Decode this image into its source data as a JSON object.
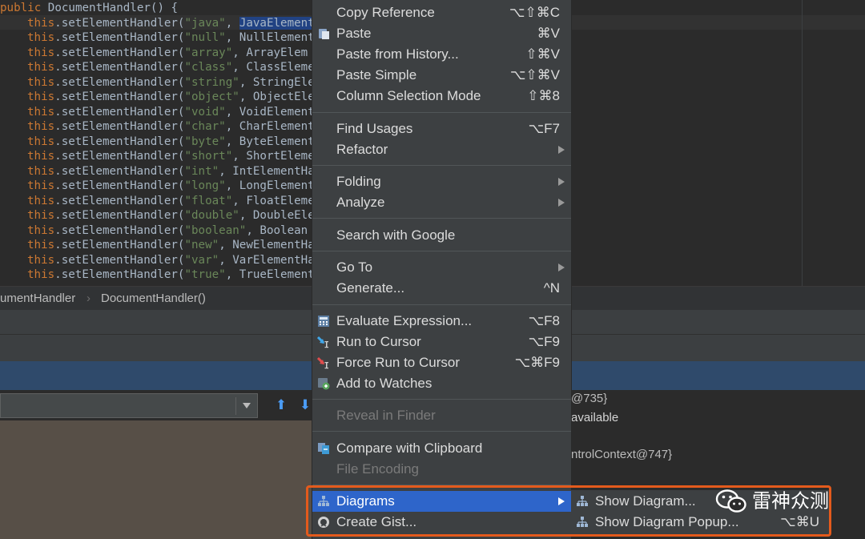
{
  "editor": {
    "lines": [
      {
        "kind": "header",
        "text": "public DocumentHandler() {"
      },
      {
        "kind": "call",
        "this": "this",
        "method": ".setElementHandler(",
        "arg": "\"java\"",
        "rest": ", JavaElement"
      },
      {
        "kind": "call",
        "this": "this",
        "method": ".setElementHandler(",
        "arg": "\"null\"",
        "rest": ", NullElement"
      },
      {
        "kind": "call",
        "this": "this",
        "method": ".setElementHandler(",
        "arg": "\"array\"",
        "rest": ", ArrayElem"
      },
      {
        "kind": "call",
        "this": "this",
        "method": ".setElementHandler(",
        "arg": "\"class\"",
        "rest": ", ClassEleme"
      },
      {
        "kind": "call",
        "this": "this",
        "method": ".setElementHandler(",
        "arg": "\"string\"",
        "rest": ", StringEle"
      },
      {
        "kind": "call",
        "this": "this",
        "method": ".setElementHandler(",
        "arg": "\"object\"",
        "rest": ", ObjectEle"
      },
      {
        "kind": "call",
        "this": "this",
        "method": ".setElementHandler(",
        "arg": "\"void\"",
        "rest": ", VoidElement"
      },
      {
        "kind": "call",
        "this": "this",
        "method": ".setElementHandler(",
        "arg": "\"char\"",
        "rest": ", CharElement"
      },
      {
        "kind": "call",
        "this": "this",
        "method": ".setElementHandler(",
        "arg": "\"byte\"",
        "rest": ", ByteElement"
      },
      {
        "kind": "call",
        "this": "this",
        "method": ".setElementHandler(",
        "arg": "\"short\"",
        "rest": ", ShortEleme"
      },
      {
        "kind": "call",
        "this": "this",
        "method": ".setElementHandler(",
        "arg": "\"int\"",
        "rest": ", IntElementHa"
      },
      {
        "kind": "call",
        "this": "this",
        "method": ".setElementHandler(",
        "arg": "\"long\"",
        "rest": ", LongElement"
      },
      {
        "kind": "call",
        "this": "this",
        "method": ".setElementHandler(",
        "arg": "\"float\"",
        "rest": ", FloatEleme"
      },
      {
        "kind": "call",
        "this": "this",
        "method": ".setElementHandler(",
        "arg": "\"double\"",
        "rest": ", DoubleEle"
      },
      {
        "kind": "call",
        "this": "this",
        "method": ".setElementHandler(",
        "arg": "\"boolean\"",
        "rest": ", Boolean"
      },
      {
        "kind": "call",
        "this": "this",
        "method": ".setElementHandler(",
        "arg": "\"new\"",
        "rest": ", NewElementHa"
      },
      {
        "kind": "call",
        "this": "this",
        "method": ".setElementHandler(",
        "arg": "\"var\"",
        "rest": ", VarElementHa"
      },
      {
        "kind": "call",
        "this": "this",
        "method": ".setElementHandler(",
        "arg": "\"true\"",
        "rest": ", TrueElement"
      }
    ],
    "selected_text": "JavaElement"
  },
  "breadcrumb": {
    "class_crumb": "umentHandler",
    "separator": "›",
    "method_crumb": "DocumentHandler()"
  },
  "debugger": {
    "var_line1": "@735}",
    "var_line2": "available",
    "var_line3": "ntrolContext@747}"
  },
  "menu": {
    "items": [
      {
        "label": "Copy Reference",
        "shortcut": "⌥⇧⌘C"
      },
      {
        "label": "Paste",
        "shortcut": "⌘V",
        "icon": "paste-icon"
      },
      {
        "label": "Paste from History...",
        "shortcut": "⇧⌘V"
      },
      {
        "label": "Paste Simple",
        "shortcut": "⌥⇧⌘V"
      },
      {
        "label": "Column Selection Mode",
        "shortcut": "⇧⌘8"
      },
      {
        "label": "Find Usages",
        "shortcut": "⌥F7"
      },
      {
        "label": "Refactor",
        "submenu": true
      },
      {
        "label": "Folding",
        "submenu": true
      },
      {
        "label": "Analyze",
        "submenu": true
      },
      {
        "label": "Search with Google"
      },
      {
        "label": "Go To",
        "submenu": true
      },
      {
        "label": "Generate...",
        "shortcut": "^N"
      },
      {
        "label": "Evaluate Expression...",
        "shortcut": "⌥F8",
        "icon": "calculator-icon"
      },
      {
        "label": "Run to Cursor",
        "shortcut": "⌥F9",
        "icon": "run-to-cursor-icon"
      },
      {
        "label": "Force Run to Cursor",
        "shortcut": "⌥⌘F9",
        "icon": "force-run-to-cursor-icon"
      },
      {
        "label": "Add to Watches",
        "icon": "add-watch-icon"
      },
      {
        "label": "Reveal in Finder",
        "disabled": true
      },
      {
        "label": "Compare with Clipboard",
        "icon": "compare-icon"
      },
      {
        "label": "File Encoding",
        "disabled": true
      },
      {
        "label": "Diagrams",
        "submenu": true,
        "active": true,
        "icon": "diagram-icon"
      },
      {
        "label": "Create Gist...",
        "icon": "github-icon"
      }
    ]
  },
  "submenu": {
    "items": [
      {
        "label": "Show Diagram...",
        "icon": "diagram-icon"
      },
      {
        "label": "Show Diagram Popup...",
        "shortcut": "⌥⌘U",
        "icon": "diagram-icon"
      }
    ]
  },
  "watermark": {
    "text": "雷神众测"
  },
  "colors": {
    "highlight_border": "#e45a1c",
    "menu_active": "#2e65ca",
    "menu_bg": "#3d4042"
  }
}
